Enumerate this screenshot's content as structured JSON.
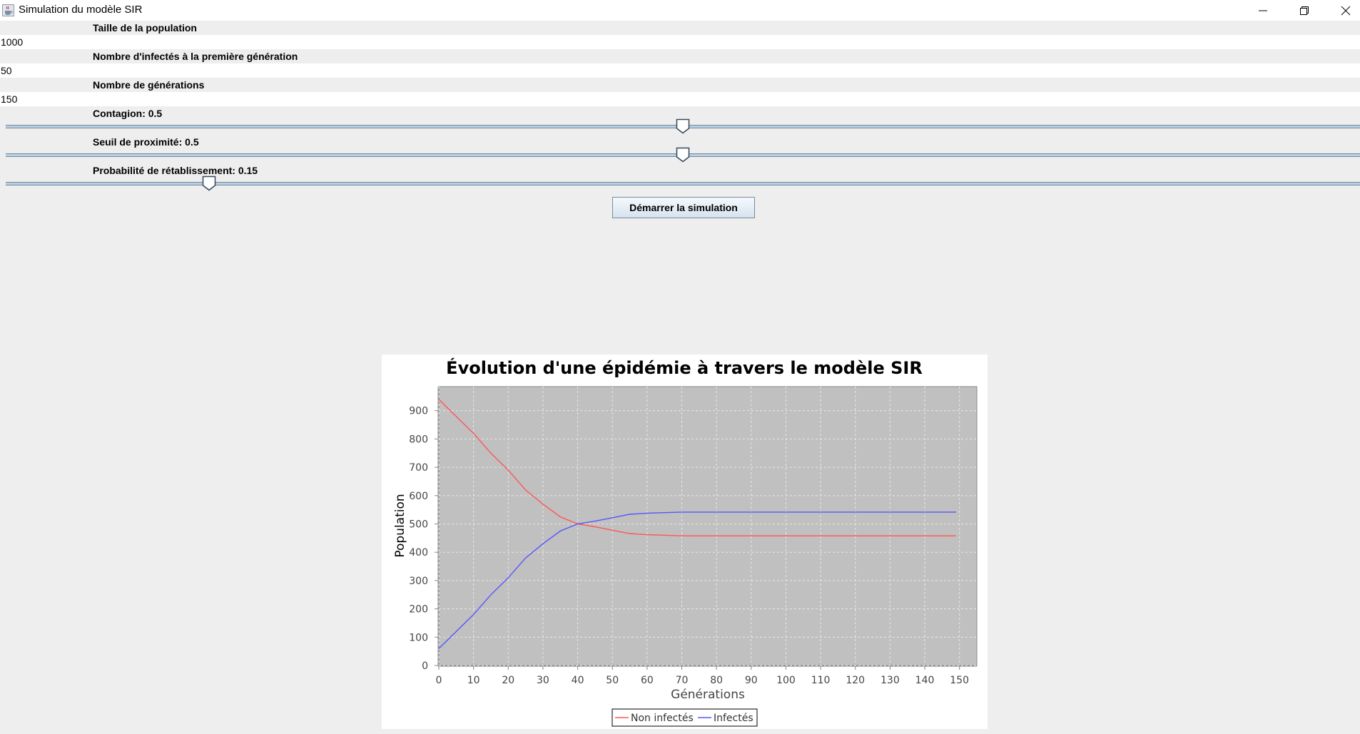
{
  "window": {
    "title": "Simulation du modèle SIR",
    "icon": "java-coffee-icon"
  },
  "form": {
    "population_label": "Taille de la population",
    "population_value": "1000",
    "initial_infected_label": "Nombre d'infectés à la première génération",
    "initial_infected_value": "50",
    "generations_label": "Nombre de générations",
    "generations_value": "150",
    "contagion_label": "Contagion: 0.5",
    "contagion_value": 0.5,
    "proximity_label": "Seuil de proximité: 0.5",
    "proximity_value": 0.5,
    "recovery_label": "Probabilité de rétablissement: 0.15",
    "recovery_value": 0.15,
    "start_button": "Démarrer la simulation"
  },
  "colors": {
    "plot_background": "#c0c0c0",
    "non_infected": "#ff5555",
    "infected": "#5555ff"
  },
  "chart_data": {
    "type": "line",
    "title": "Évolution d'une épidémie à travers le modèle SIR",
    "xlabel": "Générations",
    "ylabel": "Population",
    "xlim": [
      0,
      155
    ],
    "ylim": [
      0,
      985
    ],
    "x_ticks": [
      0,
      10,
      20,
      30,
      40,
      50,
      60,
      70,
      80,
      90,
      100,
      110,
      120,
      130,
      140,
      150
    ],
    "y_ticks": [
      0,
      100,
      200,
      300,
      400,
      500,
      600,
      700,
      800,
      900
    ],
    "grid": true,
    "legend_position": "bottom",
    "series": [
      {
        "name": "Non infectés",
        "color": "#ff5555",
        "x": [
          0,
          5,
          10,
          15,
          20,
          25,
          30,
          35,
          40,
          45,
          50,
          55,
          60,
          70,
          80,
          100,
          120,
          149
        ],
        "y": [
          940,
          880,
          820,
          750,
          690,
          620,
          570,
          525,
          500,
          490,
          478,
          466,
          462,
          458,
          458,
          458,
          458,
          458
        ]
      },
      {
        "name": "Infectés",
        "color": "#5555ff",
        "x": [
          0,
          5,
          10,
          15,
          20,
          25,
          30,
          35,
          40,
          45,
          50,
          55,
          60,
          70,
          80,
          100,
          120,
          149
        ],
        "y": [
          60,
          120,
          180,
          250,
          310,
          380,
          430,
          475,
          500,
          510,
          522,
          534,
          538,
          542,
          542,
          542,
          542,
          542
        ]
      }
    ]
  }
}
